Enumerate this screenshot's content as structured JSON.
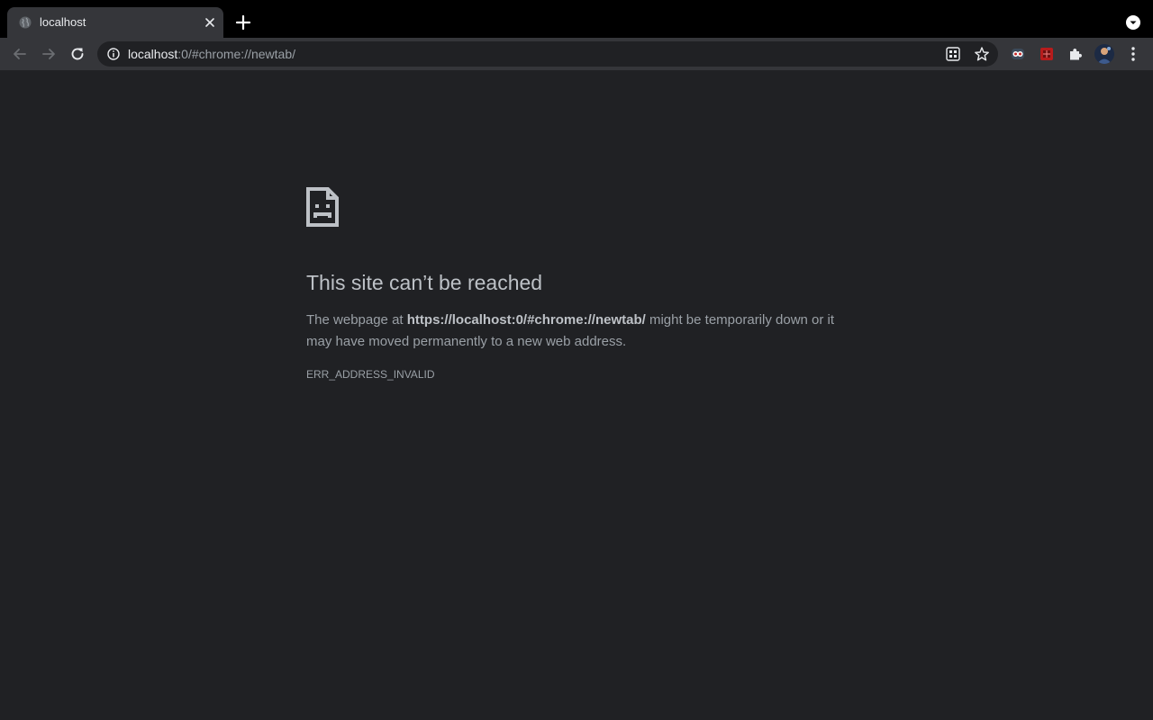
{
  "tab": {
    "title": "localhost",
    "favicon": "globe-icon"
  },
  "toolbar": {
    "back": "back-arrow-icon",
    "forward": "forward-arrow-icon",
    "reload": "reload-icon"
  },
  "omnibox": {
    "host": "localhost",
    "path": ":0/#chrome://newtab/",
    "info_icon": "info-icon"
  },
  "extensions": [
    "owl-extension-icon",
    "red-extension-icon",
    "puzzle-extensions-icon"
  ],
  "error": {
    "icon": "sad-page-icon",
    "title": "This site can’t be reached",
    "desc_prefix": "The webpage at ",
    "url": "https://localhost:0/#chrome://newtab/",
    "desc_suffix": " might be temporarily down or it may have moved permanently to a new web address.",
    "code": "ERR_ADDRESS_INVALID"
  },
  "colors": {
    "page_background": "#202124",
    "toolbar": "#35363a",
    "tabstrip": "#000000",
    "heading": "#bdc1c6",
    "body_text": "#9aa0a6"
  }
}
